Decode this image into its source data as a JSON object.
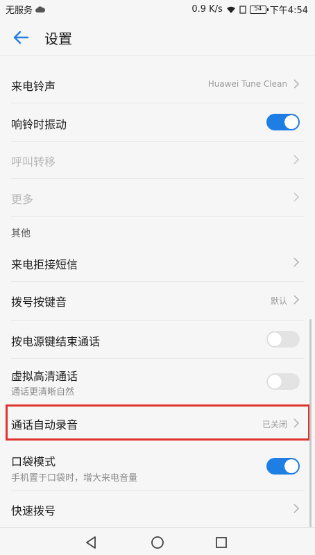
{
  "statusbar": {
    "carrier": "无服务",
    "speed": "0.9 K/s",
    "battery": "54",
    "time": "下午4:54"
  },
  "appbar": {
    "title": "设置"
  },
  "section_partial": "其他",
  "rows": {
    "ringtone": {
      "label": "来电铃声",
      "value": "Huawei Tune Clean"
    },
    "vibrate": {
      "label": "响铃时振动",
      "toggle": "on"
    },
    "call_forward": {
      "label": "呼叫转移"
    },
    "more": {
      "label": "更多"
    },
    "reject_sms": {
      "label": "来电拒接短信"
    },
    "dial_tone": {
      "label": "拨号按键音",
      "value": "默认"
    },
    "power_end_call": {
      "label": "按电源键结束通话",
      "toggle": "off"
    },
    "hd_call": {
      "label": "虚拟高清通话",
      "sub": "通话更清晰自然",
      "toggle": "off"
    },
    "auto_record": {
      "label": "通话自动录音",
      "value": "已关闭"
    },
    "pocket_mode": {
      "label": "口袋模式",
      "sub": "手机置于口袋时，增大来电音量",
      "toggle": "on"
    },
    "speed_dial": {
      "label": "快速拨号"
    }
  },
  "group_other": "其他",
  "colors": {
    "accent": "#1e7ee3",
    "highlight": "#e0332d"
  },
  "icons": [
    "back-arrow-icon",
    "chevron-right-icon",
    "nav-back-icon",
    "nav-home-icon",
    "nav-recents-icon",
    "cloud-icon",
    "wifi-icon"
  ]
}
